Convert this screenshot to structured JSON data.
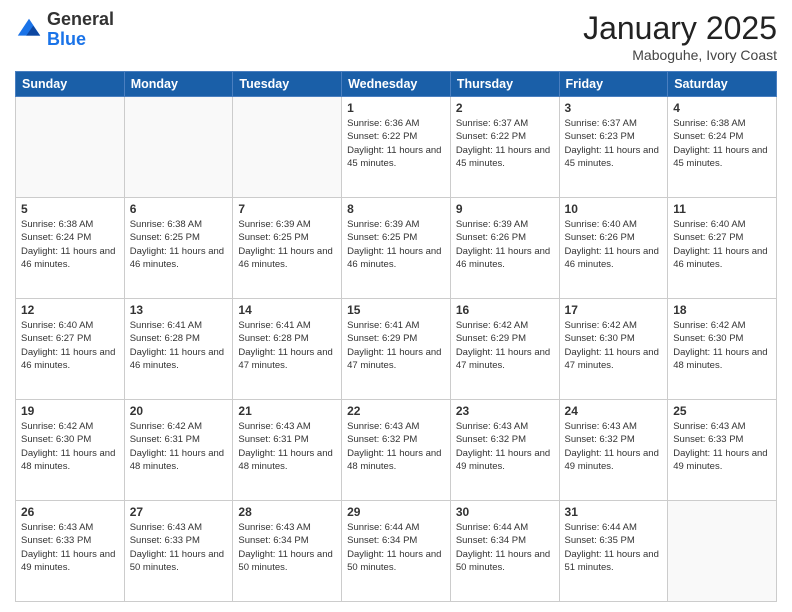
{
  "header": {
    "logo_general": "General",
    "logo_blue": "Blue",
    "title": "January 2025",
    "subtitle": "Maboguhe, Ivory Coast"
  },
  "days_of_week": [
    "Sunday",
    "Monday",
    "Tuesday",
    "Wednesday",
    "Thursday",
    "Friday",
    "Saturday"
  ],
  "weeks": [
    [
      {
        "day": "",
        "info": ""
      },
      {
        "day": "",
        "info": ""
      },
      {
        "day": "",
        "info": ""
      },
      {
        "day": "1",
        "info": "Sunrise: 6:36 AM\nSunset: 6:22 PM\nDaylight: 11 hours\nand 45 minutes."
      },
      {
        "day": "2",
        "info": "Sunrise: 6:37 AM\nSunset: 6:22 PM\nDaylight: 11 hours\nand 45 minutes."
      },
      {
        "day": "3",
        "info": "Sunrise: 6:37 AM\nSunset: 6:23 PM\nDaylight: 11 hours\nand 45 minutes."
      },
      {
        "day": "4",
        "info": "Sunrise: 6:38 AM\nSunset: 6:24 PM\nDaylight: 11 hours\nand 45 minutes."
      }
    ],
    [
      {
        "day": "5",
        "info": "Sunrise: 6:38 AM\nSunset: 6:24 PM\nDaylight: 11 hours\nand 46 minutes."
      },
      {
        "day": "6",
        "info": "Sunrise: 6:38 AM\nSunset: 6:25 PM\nDaylight: 11 hours\nand 46 minutes."
      },
      {
        "day": "7",
        "info": "Sunrise: 6:39 AM\nSunset: 6:25 PM\nDaylight: 11 hours\nand 46 minutes."
      },
      {
        "day": "8",
        "info": "Sunrise: 6:39 AM\nSunset: 6:25 PM\nDaylight: 11 hours\nand 46 minutes."
      },
      {
        "day": "9",
        "info": "Sunrise: 6:39 AM\nSunset: 6:26 PM\nDaylight: 11 hours\nand 46 minutes."
      },
      {
        "day": "10",
        "info": "Sunrise: 6:40 AM\nSunset: 6:26 PM\nDaylight: 11 hours\nand 46 minutes."
      },
      {
        "day": "11",
        "info": "Sunrise: 6:40 AM\nSunset: 6:27 PM\nDaylight: 11 hours\nand 46 minutes."
      }
    ],
    [
      {
        "day": "12",
        "info": "Sunrise: 6:40 AM\nSunset: 6:27 PM\nDaylight: 11 hours\nand 46 minutes."
      },
      {
        "day": "13",
        "info": "Sunrise: 6:41 AM\nSunset: 6:28 PM\nDaylight: 11 hours\nand 46 minutes."
      },
      {
        "day": "14",
        "info": "Sunrise: 6:41 AM\nSunset: 6:28 PM\nDaylight: 11 hours\nand 47 minutes."
      },
      {
        "day": "15",
        "info": "Sunrise: 6:41 AM\nSunset: 6:29 PM\nDaylight: 11 hours\nand 47 minutes."
      },
      {
        "day": "16",
        "info": "Sunrise: 6:42 AM\nSunset: 6:29 PM\nDaylight: 11 hours\nand 47 minutes."
      },
      {
        "day": "17",
        "info": "Sunrise: 6:42 AM\nSunset: 6:30 PM\nDaylight: 11 hours\nand 47 minutes."
      },
      {
        "day": "18",
        "info": "Sunrise: 6:42 AM\nSunset: 6:30 PM\nDaylight: 11 hours\nand 48 minutes."
      }
    ],
    [
      {
        "day": "19",
        "info": "Sunrise: 6:42 AM\nSunset: 6:30 PM\nDaylight: 11 hours\nand 48 minutes."
      },
      {
        "day": "20",
        "info": "Sunrise: 6:42 AM\nSunset: 6:31 PM\nDaylight: 11 hours\nand 48 minutes."
      },
      {
        "day": "21",
        "info": "Sunrise: 6:43 AM\nSunset: 6:31 PM\nDaylight: 11 hours\nand 48 minutes."
      },
      {
        "day": "22",
        "info": "Sunrise: 6:43 AM\nSunset: 6:32 PM\nDaylight: 11 hours\nand 48 minutes."
      },
      {
        "day": "23",
        "info": "Sunrise: 6:43 AM\nSunset: 6:32 PM\nDaylight: 11 hours\nand 49 minutes."
      },
      {
        "day": "24",
        "info": "Sunrise: 6:43 AM\nSunset: 6:32 PM\nDaylight: 11 hours\nand 49 minutes."
      },
      {
        "day": "25",
        "info": "Sunrise: 6:43 AM\nSunset: 6:33 PM\nDaylight: 11 hours\nand 49 minutes."
      }
    ],
    [
      {
        "day": "26",
        "info": "Sunrise: 6:43 AM\nSunset: 6:33 PM\nDaylight: 11 hours\nand 49 minutes."
      },
      {
        "day": "27",
        "info": "Sunrise: 6:43 AM\nSunset: 6:33 PM\nDaylight: 11 hours\nand 50 minutes."
      },
      {
        "day": "28",
        "info": "Sunrise: 6:43 AM\nSunset: 6:34 PM\nDaylight: 11 hours\nand 50 minutes."
      },
      {
        "day": "29",
        "info": "Sunrise: 6:44 AM\nSunset: 6:34 PM\nDaylight: 11 hours\nand 50 minutes."
      },
      {
        "day": "30",
        "info": "Sunrise: 6:44 AM\nSunset: 6:34 PM\nDaylight: 11 hours\nand 50 minutes."
      },
      {
        "day": "31",
        "info": "Sunrise: 6:44 AM\nSunset: 6:35 PM\nDaylight: 11 hours\nand 51 minutes."
      },
      {
        "day": "",
        "info": ""
      }
    ]
  ]
}
